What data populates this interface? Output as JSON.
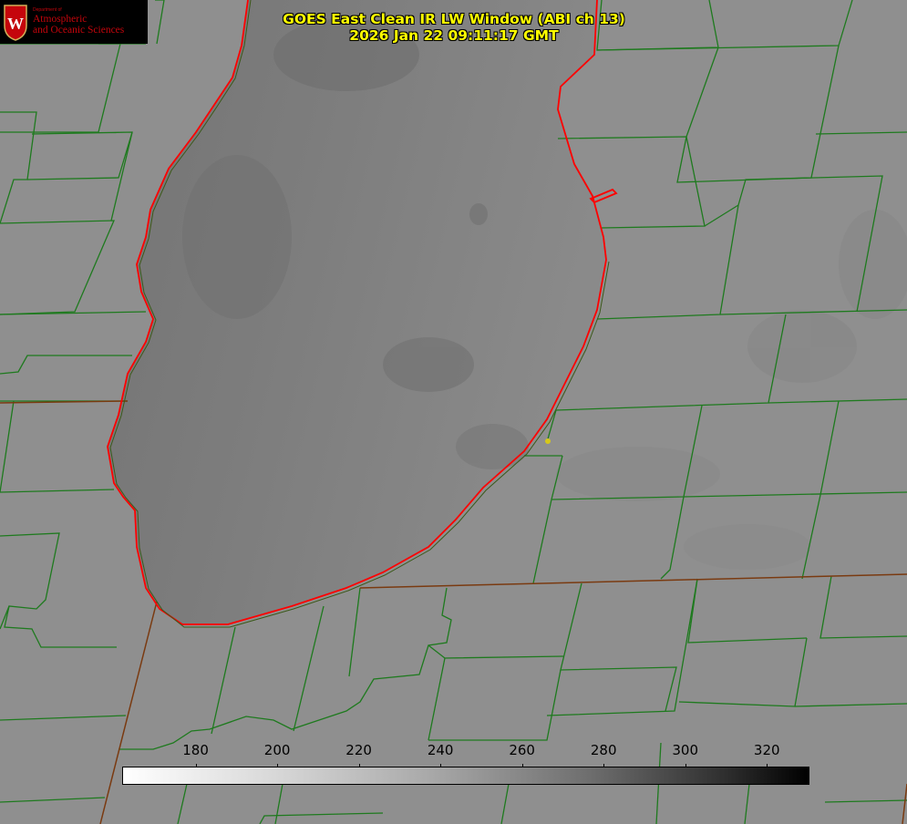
{
  "title": {
    "line1": "GOES East Clean IR LW Window (ABI ch 13)",
    "line2": "2026 Jan 22 09:11:17 GMT"
  },
  "logo": {
    "department": "Department of",
    "line1": "Atmospheric",
    "line2": "and Oceanic Sciences",
    "crest_letter": "W"
  },
  "colorbar": {
    "unit_min": 162,
    "unit_max": 330,
    "ticks": [
      "180",
      "200",
      "220",
      "240",
      "260",
      "280",
      "300",
      "320"
    ],
    "colors": {
      "low": "#ffffff",
      "high": "#000000"
    }
  },
  "map_colors": {
    "background": "#8e8e8e",
    "lake_cloud": "#7c7c7c",
    "county_lines": "#1e7a1e",
    "shoreline": "#ff0000",
    "state_lines": "#7a3a10",
    "marker": "#d6c81a"
  }
}
